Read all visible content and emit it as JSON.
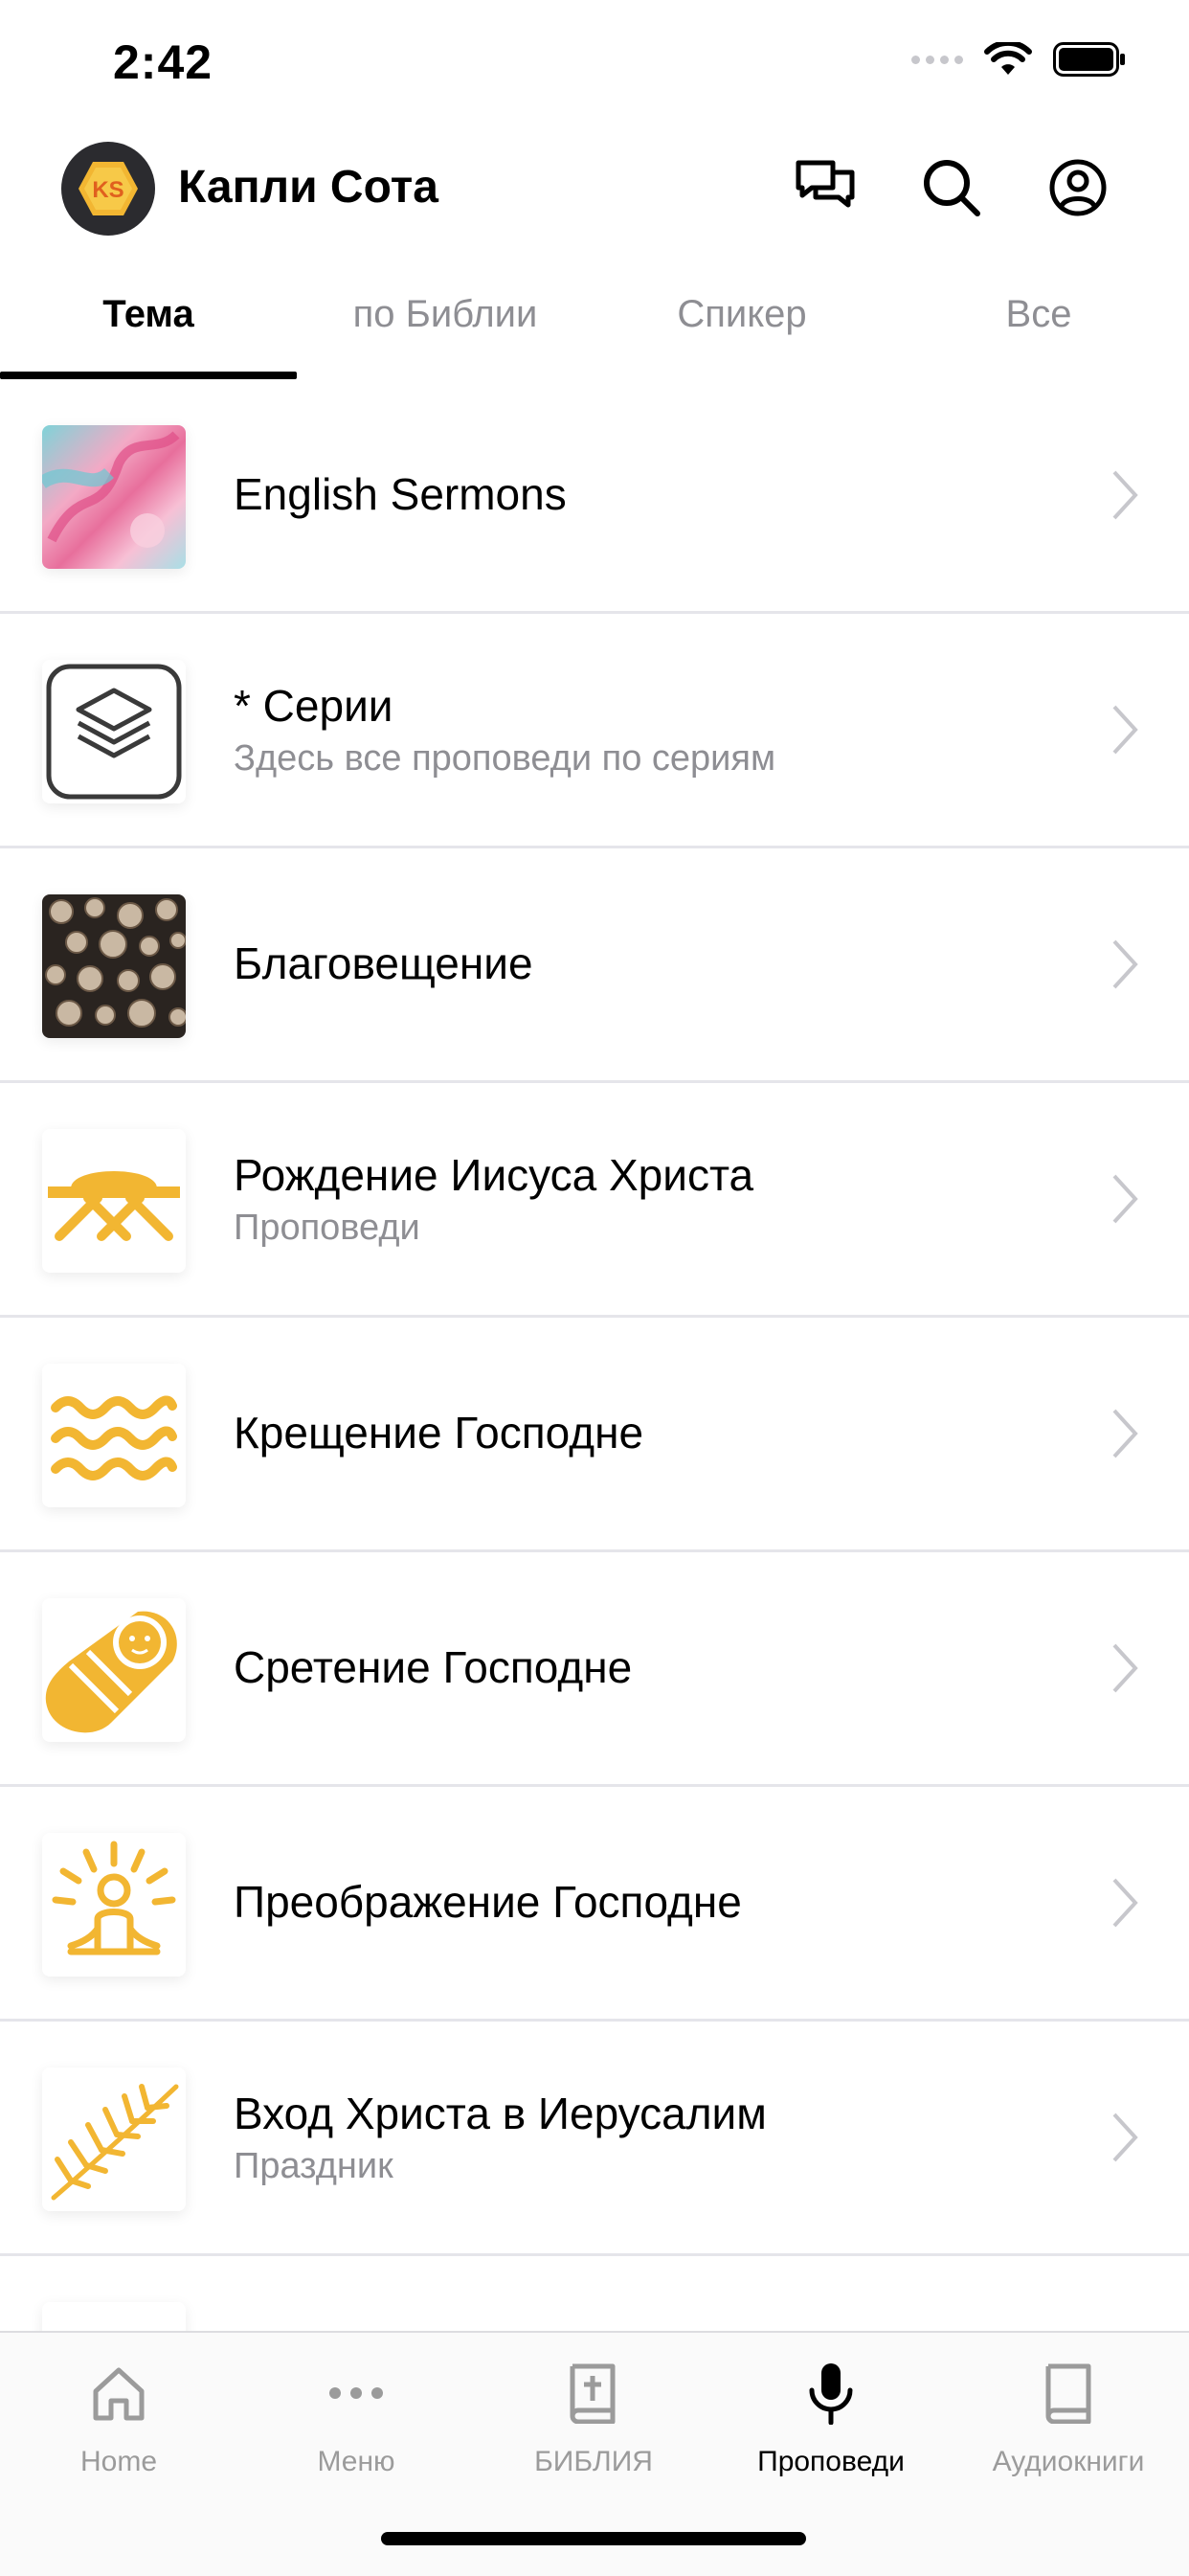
{
  "status_bar": {
    "time": "2:42"
  },
  "header": {
    "title": "Капли Сота",
    "logo_text": "KS"
  },
  "tabs": [
    {
      "label": "Тема",
      "active": true
    },
    {
      "label": "по Библии"
    },
    {
      "label": "Спикер"
    },
    {
      "label": "Все"
    }
  ],
  "list": [
    {
      "title": "English Sermons",
      "subtitle": "",
      "icon": "abstract-paint-image"
    },
    {
      "title": "* Серии",
      "subtitle": "Здесь все проповеди по сериям",
      "icon": "layers-icon"
    },
    {
      "title": "Благовещение",
      "subtitle": "",
      "icon": "wood-logs-image"
    },
    {
      "title": "Рождение Иисуса Христа",
      "subtitle": "Проповеди",
      "icon": "manger-icon"
    },
    {
      "title": "Крещение Господне",
      "subtitle": "",
      "icon": "waves-icon"
    },
    {
      "title": "Сретение Господне",
      "subtitle": "",
      "icon": "swaddled-baby-icon"
    },
    {
      "title": "Преображение Господне",
      "subtitle": "",
      "icon": "radiant-figure-icon"
    },
    {
      "title": "Вход Христа в Иерусалим",
      "subtitle": "Праздник",
      "icon": "palm-branch-icon"
    }
  ],
  "tabbar": [
    {
      "label": "Home",
      "icon": "home-icon"
    },
    {
      "label": "Меню",
      "icon": "more-icon"
    },
    {
      "label": "БИБЛИЯ",
      "icon": "bible-icon"
    },
    {
      "label": "Проповеди",
      "icon": "microphone-icon",
      "active": true
    },
    {
      "label": "Аудиокниги",
      "icon": "audiobook-icon"
    }
  ],
  "colors": {
    "accent": "#F2B632",
    "inactive": "#9B9B9B",
    "separator": "#E5E5EA"
  }
}
